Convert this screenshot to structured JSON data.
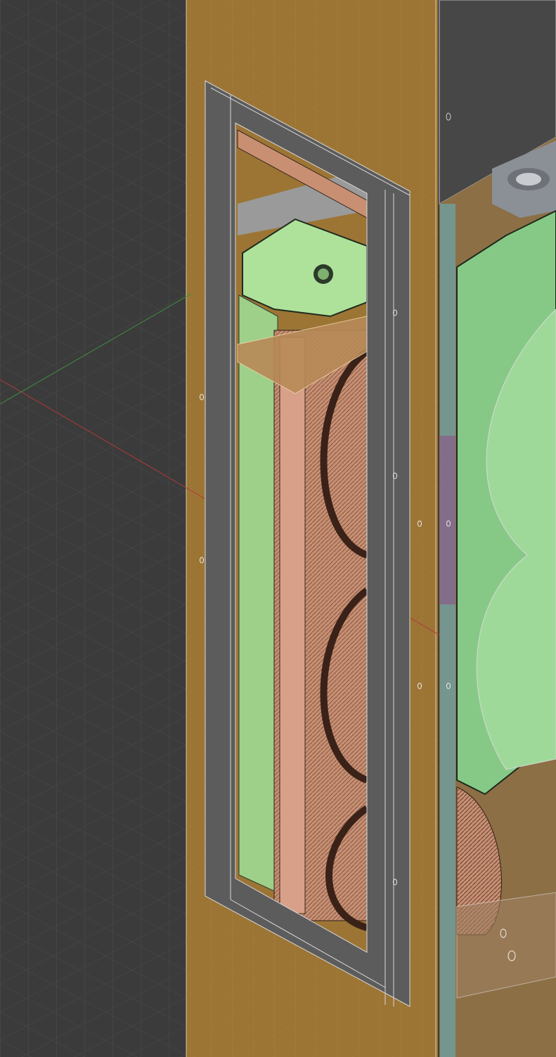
{
  "viewport": {
    "type": "3d-viewport",
    "colors": {
      "background": "#3b3b3b",
      "grid": "#4a4a4a",
      "panel_orange": "#9c7535",
      "frame_gray": "#5c5c5c",
      "frame_edge": "#d8d8d8",
      "green_part": "#9ed08a",
      "copper_part": "#c98f72",
      "dark_box": "#474747",
      "axis_x": "#b03a3a",
      "axis_y": "#3f8f3f"
    }
  }
}
